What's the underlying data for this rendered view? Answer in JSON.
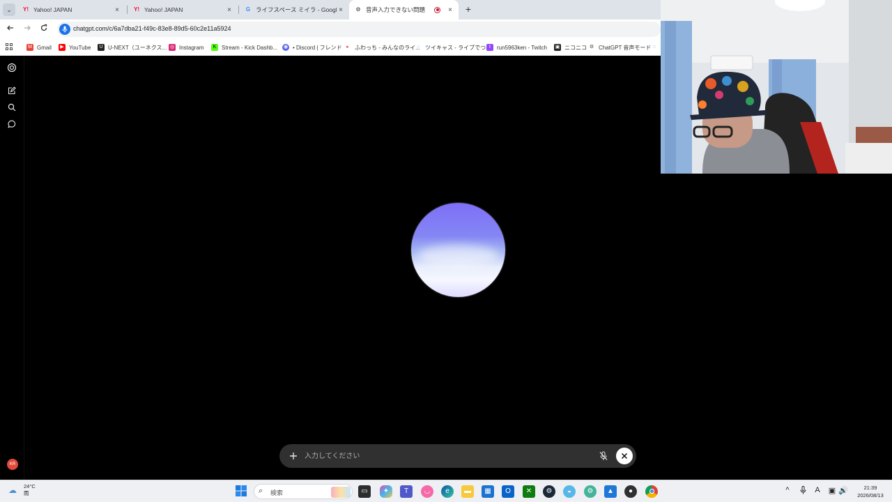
{
  "browser": {
    "tabs": [
      {
        "title": "Yahoo! JAPAN",
        "favicon": "yahoo-icon",
        "active": false
      },
      {
        "title": "Yahoo! JAPAN",
        "favicon": "yahoo-icon",
        "active": false
      },
      {
        "title": "ライフスペース ミイラ - Google 検索",
        "favicon": "google-icon",
        "active": false
      },
      {
        "title": "音声入力できない問題",
        "favicon": "chatgpt-icon",
        "active": true,
        "recording": true
      }
    ],
    "new_tab_label": "+",
    "close_glyph": "×",
    "url": "chatgpt.com/c/6a7dba21-f49c-83e8-89d5-60c2e11a5924",
    "bookmarks": [
      {
        "label": "Gmail",
        "icon": "gmail-icon",
        "color": "#ea4335"
      },
      {
        "label": "YouTube",
        "icon": "youtube-icon",
        "color": "#ff0000"
      },
      {
        "label": "U-NEXT（ユーネクス...",
        "icon": "unext-icon",
        "color": "#222222"
      },
      {
        "label": "Instagram",
        "icon": "instagram-icon",
        "color": "#d62976"
      },
      {
        "label": "Stream - Kick Dashb...",
        "icon": "kick-icon",
        "color": "#53fc18"
      },
      {
        "label": "• Discord | フレンド",
        "icon": "discord-icon",
        "color": "#5865f2"
      },
      {
        "label": "ふわっち - みんなのライ...",
        "icon": "fuwacchi-icon",
        "color": "#e53935"
      },
      {
        "label": "ツイキャス - ライブでつ...",
        "icon": "twitcasting-icon",
        "color": "#1e88e5"
      },
      {
        "label": "run5963ken - Twitch",
        "icon": "twitch-icon",
        "color": "#9146ff"
      },
      {
        "label": "ニコニコ",
        "icon": "niconico-icon",
        "color": "#252525"
      },
      {
        "label": "ChatGPT 音声モード",
        "icon": "chatgpt-icon",
        "color": "#444444"
      }
    ]
  },
  "app": {
    "composer_placeholder": "入力してください",
    "avatar_initials": "KR"
  },
  "taskbar": {
    "weather_temp": "24°C",
    "weather_desc": "雨",
    "search_label": "検索",
    "time": "21:39",
    "date": "2026/08/13",
    "ime_label": "A"
  },
  "colors": {
    "orb_top": "#7e6ff6",
    "orb_bottom": "#f6f7ff",
    "composer_bg": "#303030",
    "avatar_bg": "#e04a3b"
  }
}
